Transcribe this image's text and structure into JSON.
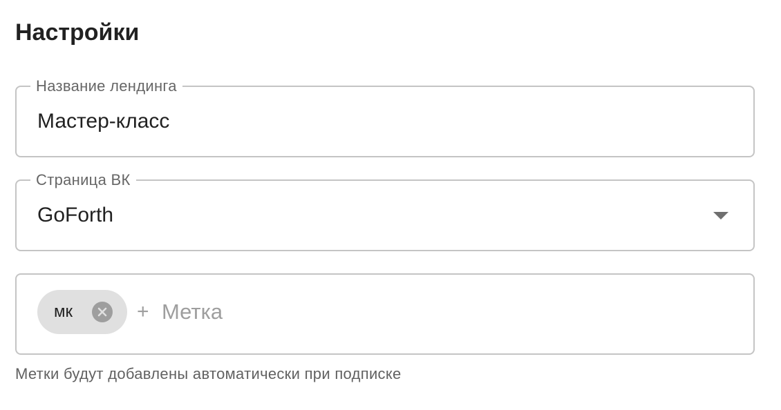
{
  "page": {
    "title": "Настройки"
  },
  "landing_name_field": {
    "label": "Название лендинга",
    "value": "Мастер-класс"
  },
  "vk_page_field": {
    "label": "Страница ВК",
    "selected": "GoForth",
    "icon": "arrow-drop-down-icon"
  },
  "tags_field": {
    "chips": [
      {
        "label": "мк",
        "remove_icon": "close-circle-icon"
      }
    ],
    "add_icon": "plus-icon",
    "add_symbol": "+",
    "placeholder": "Метка",
    "helper_text": "Метки будут добавлены автоматически при подписке"
  },
  "colors": {
    "border": "#c4c4c4",
    "chip_background": "#e0e0e0",
    "chip_remove": "#9e9e9e",
    "placeholder": "#9e9e9e",
    "helper_text": "#616161"
  }
}
